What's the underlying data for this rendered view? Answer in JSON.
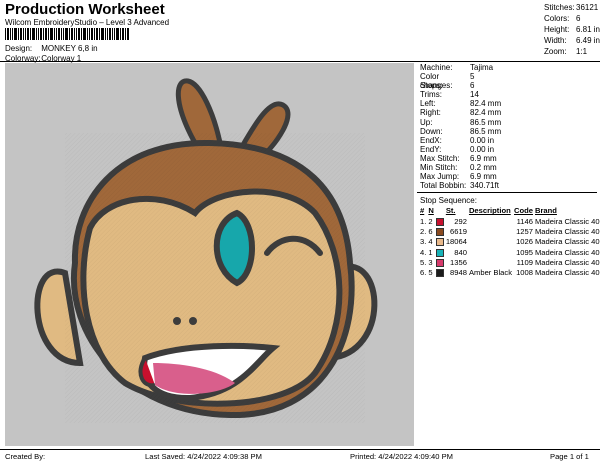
{
  "header": {
    "title": "Production Worksheet",
    "subtitle": "Wilcom EmbroideryStudio – Level 3 Advanced",
    "design_label": "Design:",
    "design_value": "MONKEY 6,8 in",
    "colorway_label": "Colorway:",
    "colorway_value": "Colorway 1"
  },
  "stats": [
    {
      "label": "Stitches:",
      "value": "36121"
    },
    {
      "label": "Colors:",
      "value": "6"
    },
    {
      "label": "Height:",
      "value": "6.81 in"
    },
    {
      "label": "Width:",
      "value": "6.49 in"
    },
    {
      "label": "Zoom:",
      "value": "1:1"
    }
  ],
  "machine": [
    {
      "label": "Machine:",
      "value": "Tajima"
    },
    {
      "label": "Color changes:",
      "value": "5"
    },
    {
      "label": "Stops:",
      "value": "6"
    },
    {
      "label": "Trims:",
      "value": "14"
    },
    {
      "label": "Left:",
      "value": "82.4 mm"
    },
    {
      "label": "Right:",
      "value": "82.4 mm"
    },
    {
      "label": "Up:",
      "value": "86.5 mm"
    },
    {
      "label": "Down:",
      "value": "86.5 mm"
    },
    {
      "label": "EndX:",
      "value": "0.00 in"
    },
    {
      "label": "EndY:",
      "value": "0.00 in"
    },
    {
      "label": "Max Stitch:",
      "value": "6.9 mm"
    },
    {
      "label": "Min Stitch:",
      "value": "0.2 mm"
    },
    {
      "label": "Max Jump:",
      "value": "6.9 mm"
    },
    {
      "label": "Total Bobbin:",
      "value": "340.71ft"
    }
  ],
  "sequence": {
    "title": "Stop Sequence:",
    "headers": [
      "#",
      "N",
      "St.",
      "Description",
      "Code",
      "Brand"
    ],
    "rows": [
      {
        "n": "1.",
        "needle": "2",
        "color": "#c8102e",
        "st": "292",
        "desc": "",
        "code": "1146",
        "brand": "Madeira Classic 40"
      },
      {
        "n": "2.",
        "needle": "6",
        "color": "#8a4a1f",
        "st": "6619",
        "desc": "",
        "code": "1257",
        "brand": "Madeira Classic 40"
      },
      {
        "n": "3.",
        "needle": "4",
        "color": "#e8b88a",
        "st": "18064",
        "desc": "",
        "code": "1026",
        "brand": "Madeira Classic 40"
      },
      {
        "n": "4.",
        "needle": "1",
        "color": "#16b3b8",
        "st": "840",
        "desc": "",
        "code": "1095",
        "brand": "Madeira Classic 40"
      },
      {
        "n": "5.",
        "needle": "3",
        "color": "#d63a6b",
        "st": "1356",
        "desc": "",
        "code": "1109",
        "brand": "Madeira Classic 40"
      },
      {
        "n": "6.",
        "needle": "5",
        "color": "#1c1c1c",
        "st": "8948",
        "desc": "Amber Black",
        "code": "1008",
        "brand": "Madeira Classic 40"
      }
    ]
  },
  "footer": {
    "created": "Created By:",
    "saved": "Last Saved: 4/24/2022 4:09:38 PM",
    "printed": "Printed: 4/24/2022 4:09:40 PM",
    "page": "Page 1 of 1"
  }
}
